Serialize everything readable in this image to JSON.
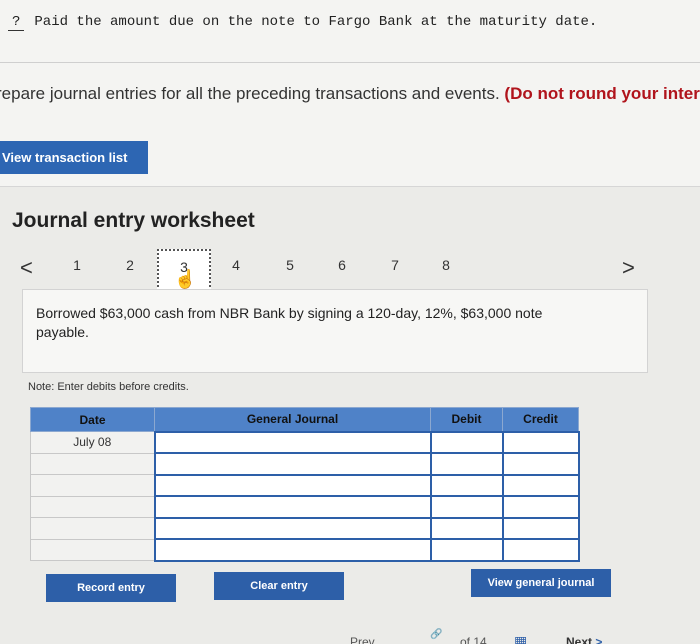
{
  "header": {
    "blank": "?",
    "prompt_text": "Paid the amount due on the note to Fargo Bank at the maturity date."
  },
  "instructions": {
    "text": "repare journal entries for all the preceding transactions and events. ",
    "emphasis": "(Do not round your interm"
  },
  "view_transaction_list_label": "View transaction list",
  "worksheet": {
    "title": "Journal entry worksheet",
    "prev_arrow": "<",
    "next_arrow": ">",
    "pages": [
      "1",
      "2",
      "3",
      "4",
      "5",
      "6",
      "7",
      "8"
    ],
    "active_page": "3",
    "description": "Borrowed $63,000 cash from NBR Bank by signing a 120-day, 12%, $63,000 note payable.",
    "note": "Note: Enter debits before credits."
  },
  "journal": {
    "headers": {
      "date": "Date",
      "general_journal": "General Journal",
      "debit": "Debit",
      "credit": "Credit"
    },
    "rows": [
      {
        "date": "July 08"
      },
      {
        "date": ""
      },
      {
        "date": ""
      },
      {
        "date": ""
      },
      {
        "date": ""
      },
      {
        "date": ""
      }
    ]
  },
  "buttons": {
    "record_entry": "Record entry",
    "clear_entry": "Clear entry",
    "view_general_journal": "View general journal"
  },
  "bottom_nav": {
    "prev": "Prev",
    "of_text": "of 14",
    "next": "Next",
    "next_arrow": ">"
  },
  "icons": {
    "cursor": "hand-pointer-icon",
    "grid": "grid-icon",
    "link": "link-icon"
  },
  "colors": {
    "primary_blue": "#2d66b3",
    "header_blue": "#4f82c8",
    "emphasis_red": "#b0141c"
  }
}
